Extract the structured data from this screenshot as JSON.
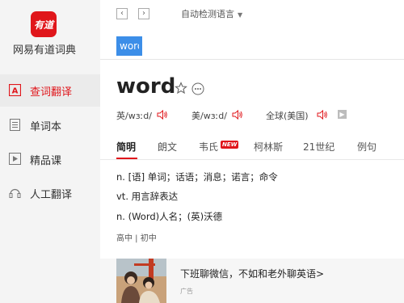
{
  "sidebar": {
    "logo_text": "有道",
    "app_name": "网易有道词典",
    "items": [
      {
        "label": "查词翻译",
        "icon": "translate-icon",
        "active": true
      },
      {
        "label": "单词本",
        "icon": "wordbook-icon",
        "active": false
      },
      {
        "label": "精品课",
        "icon": "course-icon",
        "active": false
      },
      {
        "label": "人工翻译",
        "icon": "human-translate-icon",
        "active": false
      }
    ]
  },
  "toolbar": {
    "back_glyph": "‹",
    "forward_glyph": "›",
    "language_label": "自动检测语言"
  },
  "search": {
    "value": "word"
  },
  "entry": {
    "headword": "word",
    "pron_uk": "英/wɜːd/",
    "pron_us": "美/wɜːd/",
    "pron_global": "全球(美国)",
    "tabs": [
      "简明",
      "朗文",
      "韦氏",
      "柯林斯",
      "21世纪",
      "例句"
    ],
    "new_badge": "NEW",
    "definitions": [
      "n. [语] 单词；话语；消息；诺言；命令",
      "vt. 用言辞表达",
      "n. (Word)人名；(英)沃德"
    ],
    "level": "高中 | 初中"
  },
  "ad": {
    "title": "下班聊微信，不如和老外聊英语>",
    "tag": "广告"
  },
  "colors": {
    "accent": "#e0161b",
    "selection": "#3c8ee8"
  }
}
